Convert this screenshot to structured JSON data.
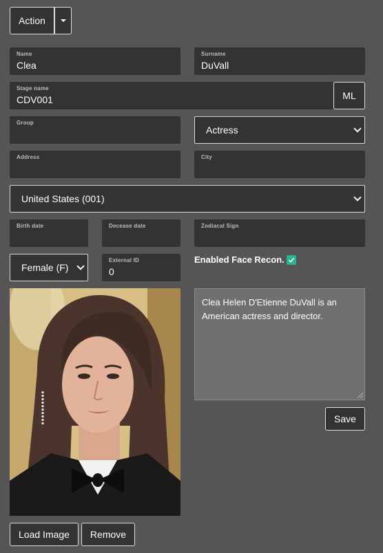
{
  "toolbar": {
    "action_label": "Action"
  },
  "form": {
    "name": {
      "label": "Name",
      "value": "Clea"
    },
    "surname": {
      "label": "Surname",
      "value": "DuVall"
    },
    "stage_name": {
      "label": "Stage name",
      "value": "CDV001"
    },
    "ml_button": "ML",
    "group": {
      "label": "Group",
      "value": ""
    },
    "role_select": "Actress",
    "address": {
      "label": "Address",
      "value": ""
    },
    "city": {
      "label": "City",
      "value": ""
    },
    "country_select": "United States (001)",
    "birth_date": {
      "label": "Birth date",
      "value": ""
    },
    "decease_date": {
      "label": "Decease date",
      "value": ""
    },
    "zodiacal_sign": {
      "label": "Zodiacal Sign",
      "value": ""
    },
    "gender_select": "Female (F)",
    "external_id": {
      "label": "External ID",
      "value": "0"
    },
    "face_recon_label": "Enabled Face Recon.",
    "face_recon_checked": true,
    "bio": "Clea Helen D'Etienne DuVall is an American actress and director."
  },
  "actions": {
    "save_label": "Save",
    "load_image_label": "Load Image",
    "remove_label": "Remove"
  },
  "colors": {
    "background": "#555555",
    "field": "#333333",
    "accent": "#2ab38e"
  }
}
